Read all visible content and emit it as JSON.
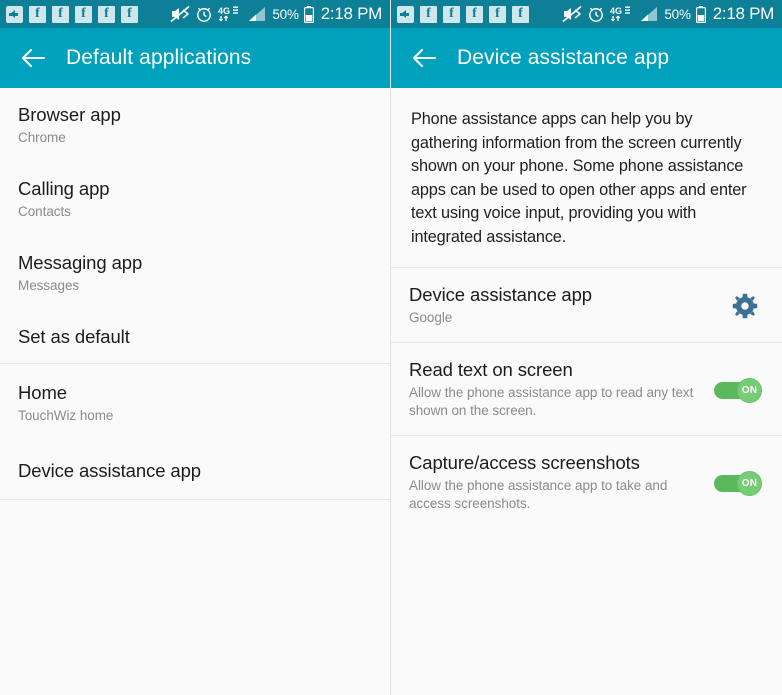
{
  "colors": {
    "statusbar_bg": "#0d7f96",
    "appbar_bg": "#00a1bd",
    "content_bg": "#fafafa",
    "gear_accent": "#3a7194",
    "toggle_track": "#5cb85c",
    "toggle_thumb": "#76cd76",
    "title_text": "#1c1c1c",
    "sub_text": "#8b8b8b"
  },
  "statusbar": {
    "icons": [
      "add-arrow-icon",
      "facebook-icon",
      "facebook-icon",
      "facebook-icon",
      "facebook-icon",
      "facebook-icon",
      "mute-vibrate-off-icon",
      "alarm-clock-icon",
      "network-4g-lte-icon",
      "signal-bars-icon"
    ],
    "facebook_glyph": "f",
    "battery_percent": "50%",
    "clock": "2:18 PM"
  },
  "left_screen": {
    "appbar": {
      "title": "Default applications",
      "back_icon": "back-arrow-icon"
    },
    "groups": [
      {
        "rows": [
          {
            "title": "Browser app",
            "subtitle": "Chrome"
          },
          {
            "title": "Calling app",
            "subtitle": "Contacts"
          },
          {
            "title": "Messaging app",
            "subtitle": "Messages"
          },
          {
            "title": "Set as default",
            "subtitle": ""
          }
        ]
      },
      {
        "rows": [
          {
            "title": "Home",
            "subtitle": "TouchWiz home"
          },
          {
            "title": "Device assistance app",
            "subtitle": ""
          }
        ]
      }
    ]
  },
  "right_screen": {
    "appbar": {
      "title": "Device assistance app",
      "back_icon": "back-arrow-icon"
    },
    "description": "Phone assistance apps can help you by gathering information from the screen currently shown on your phone. Some phone assistance apps can be used to open other apps and enter text using voice input, providing you with integrated assistance.",
    "rows": [
      {
        "title": "Device assistance app",
        "subtitle": "Google",
        "control": "gear-icon",
        "gear_icon_name": "gear-icon"
      },
      {
        "title": "Read text on screen",
        "subtitle": "Allow the phone assistance app to read any text shown on the screen.",
        "control": "toggle",
        "toggle_label": "ON",
        "toggle_state": "on"
      },
      {
        "title": "Capture/access screenshots",
        "subtitle": "Allow the phone assistance app to take and access screenshots.",
        "control": "toggle",
        "toggle_label": "ON",
        "toggle_state": "on"
      }
    ]
  }
}
